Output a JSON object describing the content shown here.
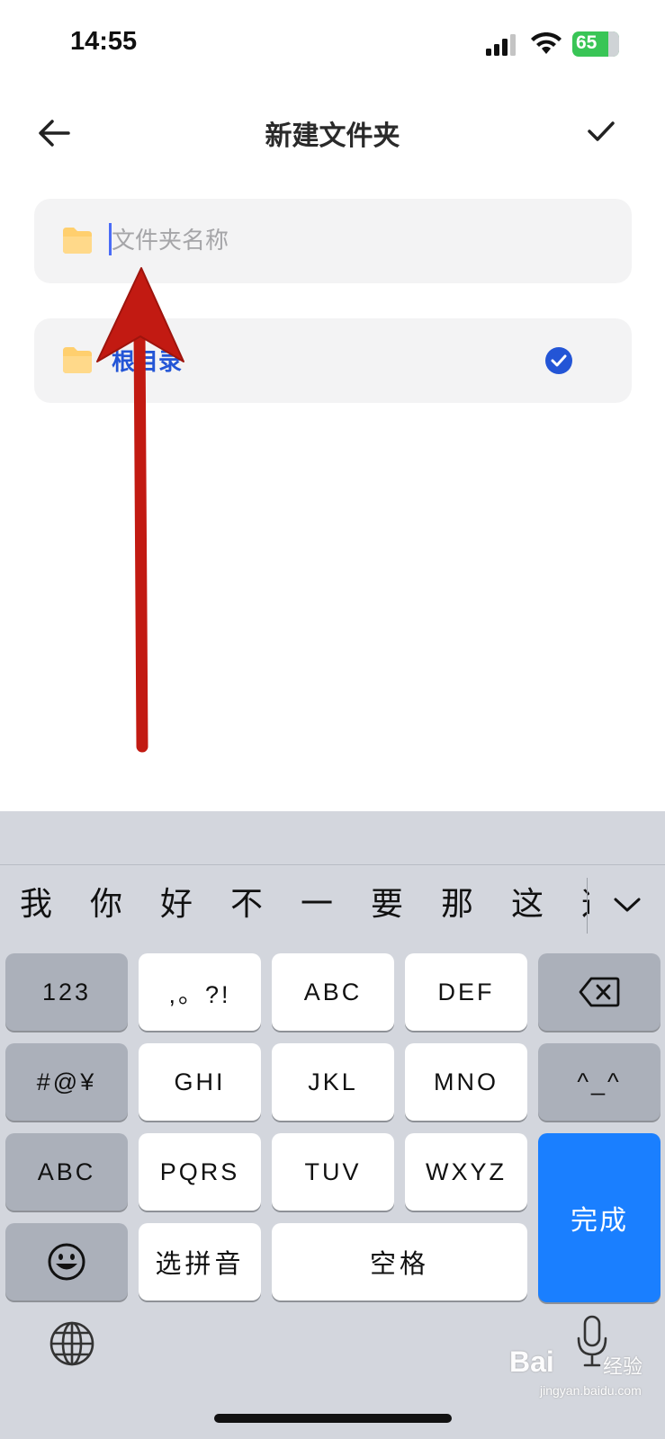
{
  "status_bar": {
    "time": "14:55",
    "battery_level": "65",
    "battery_charging": true
  },
  "nav": {
    "title": "新建文件夹",
    "back_icon": "arrow-left-icon",
    "confirm_icon": "checkmark-icon"
  },
  "name_field": {
    "placeholder": "文件夹名称",
    "value": "",
    "icon": "folder-icon"
  },
  "directory": {
    "label": "根目录",
    "selected": true,
    "icon": "folder-icon",
    "check_icon": "check-circle-icon"
  },
  "keyboard": {
    "candidates": [
      "我",
      "你",
      "好",
      "不",
      "一",
      "要",
      "那",
      "这",
      "这"
    ],
    "rows": [
      [
        "123",
        ",。?!",
        "ABC",
        "DEF",
        "delete"
      ],
      [
        "#@¥",
        "GHI",
        "JKL",
        "MNO",
        "^_^"
      ],
      [
        "ABC",
        "PQRS",
        "TUV",
        "WXYZ",
        "完成"
      ],
      [
        "emoji",
        "选拼音",
        "空格"
      ]
    ],
    "done_label": "完成",
    "space_label": "空格",
    "pinyin_label": "选拼音"
  },
  "watermark": {
    "brand": "Bai",
    "brand_cn": "经验",
    "url": "jingyan.baidu.com"
  },
  "colors": {
    "accent_blue": "#1a7fff",
    "link_blue": "#2355d6",
    "annotation_red": "#c21a12",
    "folder_yellow": "#ffcf6e"
  }
}
